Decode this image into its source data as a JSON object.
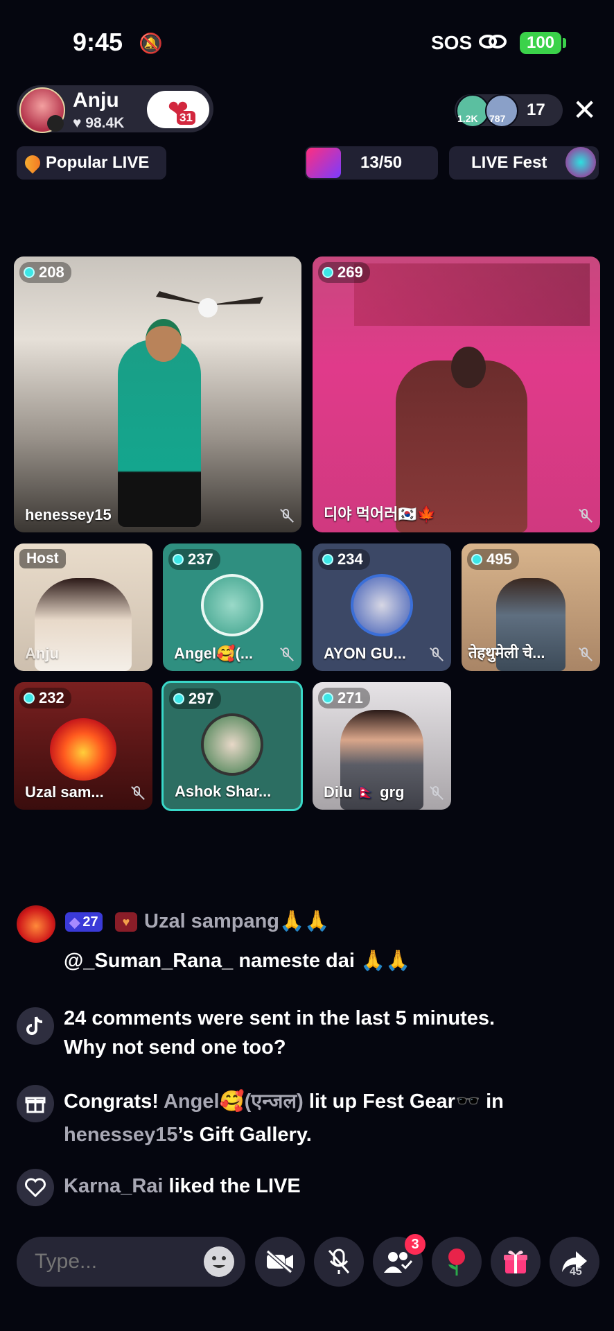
{
  "status": {
    "time": "9:45",
    "sos": "SOS",
    "battery": "100"
  },
  "host": {
    "name": "Anju",
    "likes": "♥ 98.4K",
    "badge_level": "31"
  },
  "viewers": {
    "badge_a": "1.2K",
    "badge_b": "787",
    "count": "17"
  },
  "pills": {
    "popular": "Popular LIVE",
    "rank": "13/50",
    "fest": "LIVE Fest"
  },
  "grid": {
    "large": [
      {
        "count": "208",
        "name": "henessey15"
      },
      {
        "count": "269",
        "name": "디야 먹어러🇰🇷🍁"
      }
    ],
    "small": [
      {
        "tag": "Host",
        "name": "Anju"
      },
      {
        "count": "237",
        "name": "Angel🥰(..."
      },
      {
        "count": "234",
        "name": "AYON GU..."
      },
      {
        "count": "495",
        "name": "तेहथुमेली चे..."
      },
      {
        "count": "232",
        "name": "Uzal sam..."
      },
      {
        "count": "297",
        "name": "Ashok Shar..."
      },
      {
        "count": "271",
        "name": "Dilu 🇳🇵 grg"
      }
    ]
  },
  "chat": {
    "m1_level": "27",
    "m1_user": "Uzal sampang🙏🙏",
    "m1_text": "@_Suman_Rana_ nameste dai 🙏🙏",
    "m2_line1": "24 comments were sent in the last 5 minutes.",
    "m2_line2": "Why not send one too?",
    "m3_a": "Congrats! ",
    "m3_user": "Angel🥰(एन्जल)",
    "m3_b": " lit up Fest Gear🕶️ in",
    "m3_owner": "henessey15",
    "m3_c": "’s Gift Gallery.",
    "m4_user": "Karna_Rai",
    "m4_text": " liked the LIVE"
  },
  "bottom": {
    "placeholder": "Type...",
    "guest_badge": "3",
    "share_count": "45"
  }
}
